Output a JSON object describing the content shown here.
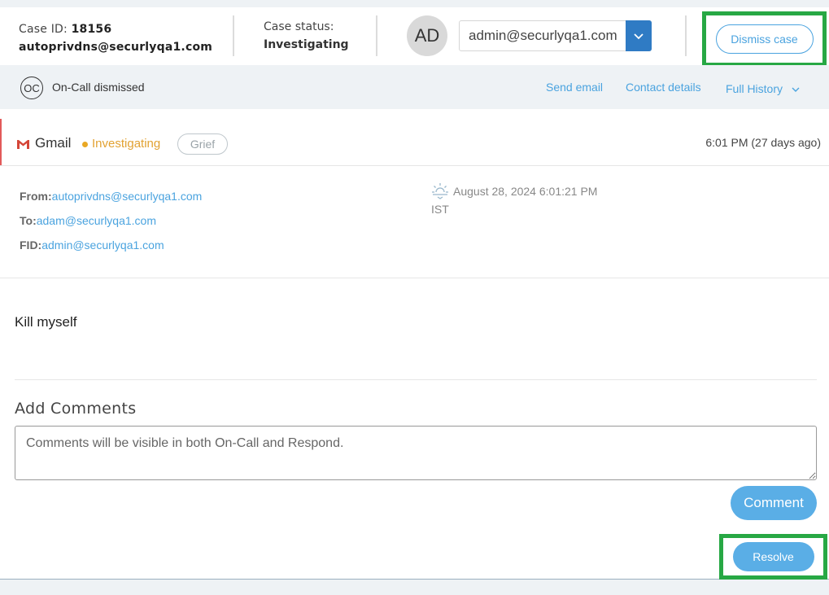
{
  "header": {
    "case_id_label": "Case ID:",
    "case_id_value": "18156",
    "case_email": "autoprivdns@securlyqa1.com",
    "case_status_label": "Case status:",
    "case_status_value": "Investigating",
    "avatar_initials": "AD",
    "assignee_select": "admin@securlyqa1.com",
    "dismiss_label": "Dismiss case"
  },
  "subbar": {
    "oc_badge": "OC",
    "oc_text": "On-Call dismissed",
    "send_email": "Send email",
    "contact_details": "Contact details",
    "full_history": "Full History"
  },
  "event": {
    "source": "Gmail",
    "status": "Investigating",
    "tag": "Grief",
    "time": "6:01 PM (27 days ago)",
    "from_label": "From:",
    "from_value": "autoprivdns@securlyqa1.com",
    "to_label": "To:",
    "to_value": "adam@securlyqa1.com",
    "fid_label": "FID:",
    "fid_value": "admin@securlyqa1.com",
    "date": "August 28, 2024 6:01:21 PM",
    "timezone": "IST",
    "message": "Kill myself"
  },
  "comments": {
    "title": "Add Comments",
    "placeholder": "Comments will be visible in both On-Call and Respond.",
    "button": "Comment"
  },
  "footer": {
    "resolve_label": "Resolve"
  },
  "colors": {
    "accent": "#4aa3df",
    "button_fill": "#5aaee6",
    "highlight": "#27a844",
    "status": "#e2a232",
    "alert_bar": "#e25a5a"
  }
}
